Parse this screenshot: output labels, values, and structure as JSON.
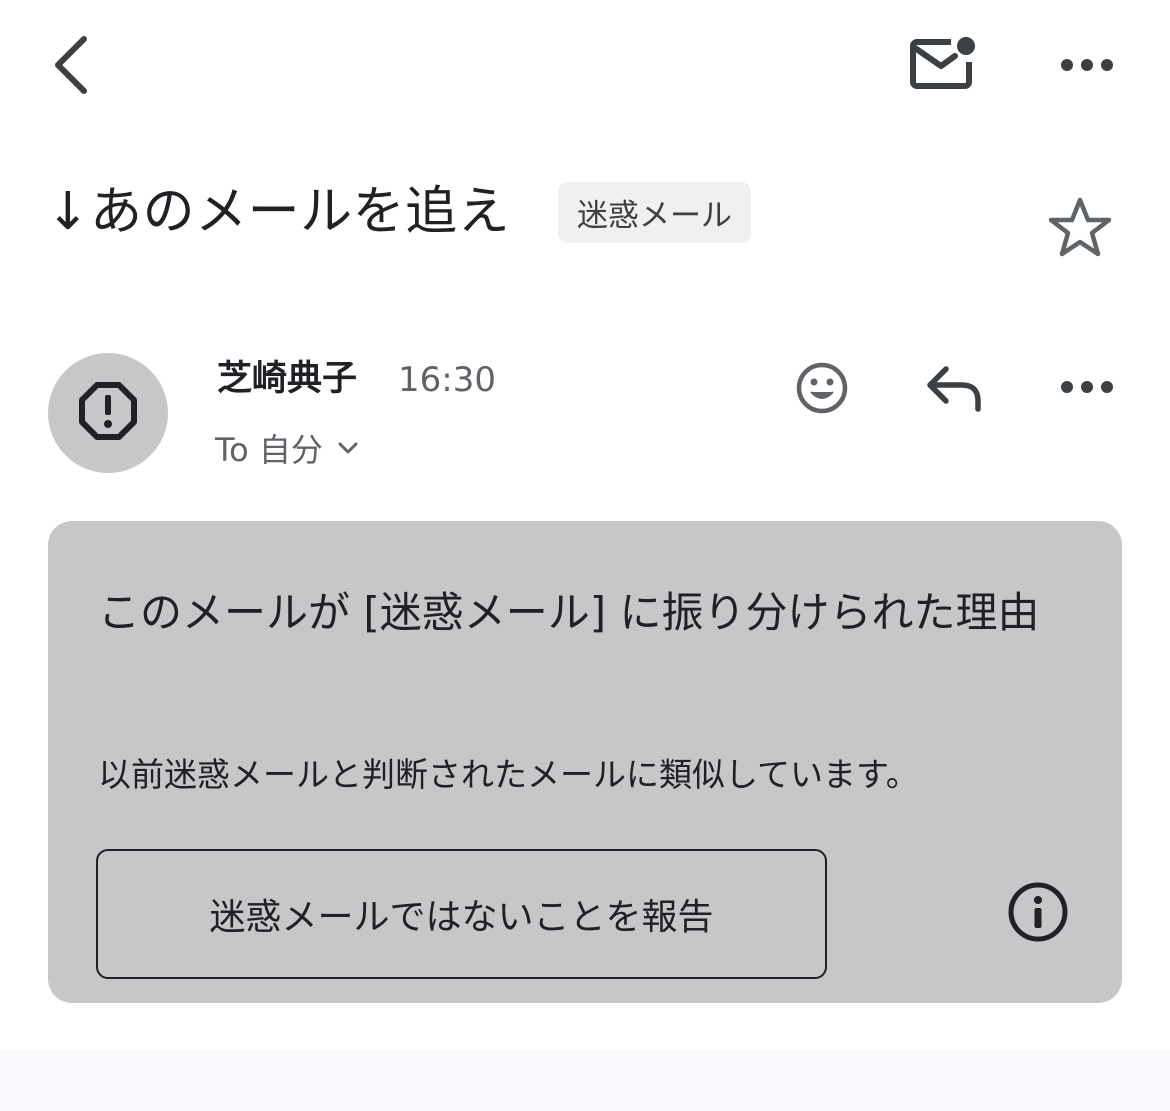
{
  "toolbar": {
    "back_icon": "chevron-left-icon",
    "mark_unread_icon": "mail-unread-icon",
    "more_icon": "more-horizontal-icon"
  },
  "subject": {
    "text": "↓あのメールを追え",
    "label": "迷惑メール",
    "star_icon": "star-outline-icon"
  },
  "message": {
    "avatar_icon": "spam-octagon-icon",
    "sender": "芝崎典子",
    "time": "16:30",
    "recipient": "To 自分",
    "recipient_toggle_icon": "chevron-down-icon",
    "reaction_icon": "smiley-icon",
    "reply_icon": "reply-icon",
    "more_icon": "more-horizontal-icon"
  },
  "spam_notice": {
    "title": "このメールが [迷惑メール] に振り分けられた理由",
    "description": "以前迷惑メールと判断されたメールに類似しています。",
    "report_button": "迷惑メールではないことを報告",
    "info_icon": "info-icon",
    "background": "#c6c7c8"
  },
  "colors": {
    "text": "#202124",
    "secondary_text": "#5f6368",
    "icon": "#3c4043",
    "label_bg": "#f0f0f0"
  }
}
